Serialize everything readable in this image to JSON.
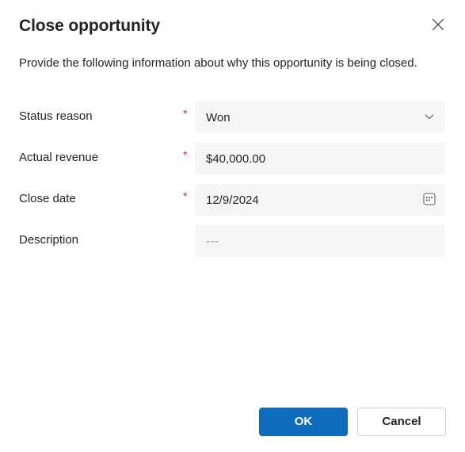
{
  "dialog": {
    "title": "Close opportunity",
    "subtitle": "Provide the following information about why this opportunity is being closed.",
    "close_icon": "close-icon",
    "required_mark": "*"
  },
  "form": {
    "fields": [
      {
        "label": "Status reason",
        "required": true,
        "control": "dropdown",
        "value": "Won",
        "affix_icon": "chevron-down-icon"
      },
      {
        "label": "Actual revenue",
        "required": true,
        "control": "text",
        "value": "$40,000.00",
        "affix_icon": ""
      },
      {
        "label": "Close date",
        "required": true,
        "control": "date",
        "value": "12/9/2024",
        "affix_icon": "calendar-icon"
      },
      {
        "label": "Description",
        "required": false,
        "control": "text",
        "value": "---",
        "is_placeholder": true,
        "affix_icon": ""
      }
    ]
  },
  "footer": {
    "ok_label": "OK",
    "cancel_label": "Cancel"
  },
  "colors": {
    "accent": "#0f6cbd",
    "required": "#c4314b",
    "field_background": "#f5f5f5",
    "text": "#242424",
    "placeholder": "#9a9a9a",
    "border": "#d1d1d1"
  }
}
